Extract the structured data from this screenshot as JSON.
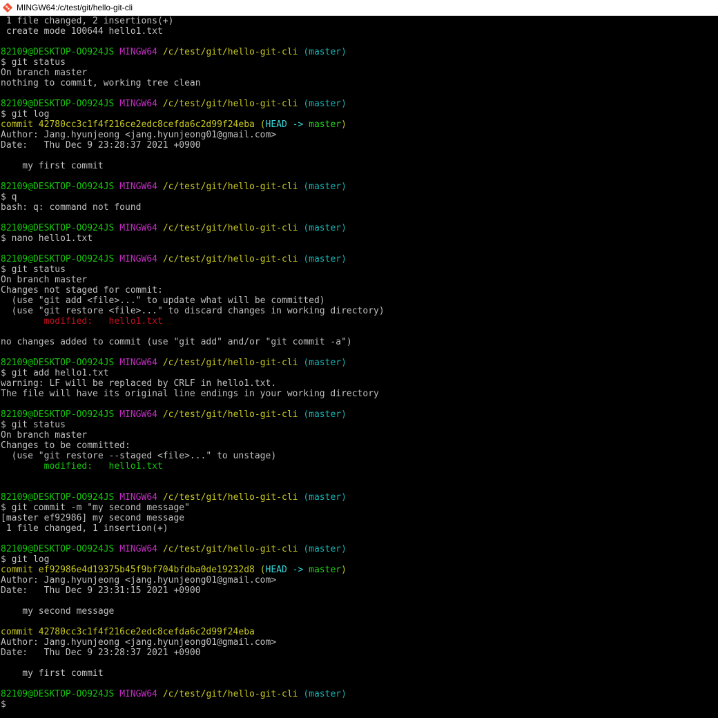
{
  "window": {
    "title": "MINGW64:/c/test/git/hello-git-cli"
  },
  "prompt": {
    "user_host": "82109@DESKTOP-OO924JS",
    "system": "MINGW64",
    "path": "/c/test/git/hello-git-cli",
    "branch": "(master)"
  },
  "colors": {
    "background": "#000000",
    "text": "#c0c0c0",
    "user_host": "#16c60c",
    "system": "#c030c0",
    "path": "#c9c920",
    "branch": "#19b2b2",
    "unstaged": "#c50f1f",
    "staged": "#16c60c"
  },
  "lines": [
    {
      "type": "text",
      "text": " 1 file changed, 2 insertions(+)"
    },
    {
      "type": "text",
      "text": " create mode 100644 hello1.txt"
    },
    {
      "type": "blank"
    },
    {
      "type": "prompt"
    },
    {
      "type": "cmd",
      "text": "$ git status"
    },
    {
      "type": "text",
      "text": "On branch master"
    },
    {
      "type": "text",
      "text": "nothing to commit, working tree clean"
    },
    {
      "type": "blank"
    },
    {
      "type": "prompt"
    },
    {
      "type": "cmd",
      "text": "$ git log"
    },
    {
      "type": "commit",
      "hash": "commit 42780cc3c1f4f216ce2edc8cefda6c2d99f24eba",
      "refs": {
        "open": " (",
        "head": "HEAD -> ",
        "branch": "master",
        "close": ")"
      }
    },
    {
      "type": "text",
      "text": "Author: Jang.hyunjeong <jang.hyunjeong01@gmail.com>"
    },
    {
      "type": "text",
      "text": "Date:   Thu Dec 9 23:28:37 2021 +0900"
    },
    {
      "type": "blank"
    },
    {
      "type": "text",
      "text": "    my first commit"
    },
    {
      "type": "blank"
    },
    {
      "type": "prompt"
    },
    {
      "type": "cmd",
      "text": "$ q"
    },
    {
      "type": "text",
      "text": "bash: q: command not found"
    },
    {
      "type": "blank"
    },
    {
      "type": "prompt"
    },
    {
      "type": "cmd",
      "text": "$ nano hello1.txt"
    },
    {
      "type": "blank"
    },
    {
      "type": "prompt"
    },
    {
      "type": "cmd",
      "text": "$ git status"
    },
    {
      "type": "text",
      "text": "On branch master"
    },
    {
      "type": "text",
      "text": "Changes not staged for commit:"
    },
    {
      "type": "text",
      "text": "  (use \"git add <file>...\" to update what will be committed)"
    },
    {
      "type": "text",
      "text": "  (use \"git restore <file>...\" to discard changes in working directory)"
    },
    {
      "type": "colored",
      "color": "red",
      "text": "        modified:   hello1.txt"
    },
    {
      "type": "blank"
    },
    {
      "type": "text",
      "text": "no changes added to commit (use \"git add\" and/or \"git commit -a\")"
    },
    {
      "type": "blank"
    },
    {
      "type": "prompt"
    },
    {
      "type": "cmd",
      "text": "$ git add hello1.txt"
    },
    {
      "type": "text",
      "text": "warning: LF will be replaced by CRLF in hello1.txt."
    },
    {
      "type": "text",
      "text": "The file will have its original line endings in your working directory"
    },
    {
      "type": "blank"
    },
    {
      "type": "prompt"
    },
    {
      "type": "cmd",
      "text": "$ git status"
    },
    {
      "type": "text",
      "text": "On branch master"
    },
    {
      "type": "text",
      "text": "Changes to be committed:"
    },
    {
      "type": "text",
      "text": "  (use \"git restore --staged <file>...\" to unstage)"
    },
    {
      "type": "colored",
      "color": "green",
      "text": "        modified:   hello1.txt"
    },
    {
      "type": "blank"
    },
    {
      "type": "blank"
    },
    {
      "type": "prompt"
    },
    {
      "type": "cmd",
      "text": "$ git commit -m \"my second message\""
    },
    {
      "type": "text",
      "text": "[master ef92986] my second message"
    },
    {
      "type": "text",
      "text": " 1 file changed, 1 insertion(+)"
    },
    {
      "type": "blank"
    },
    {
      "type": "prompt"
    },
    {
      "type": "cmd",
      "text": "$ git log"
    },
    {
      "type": "commit",
      "hash": "commit ef92986e4d19375b45f9bf704bfdba0de19232d8",
      "refs": {
        "open": " (",
        "head": "HEAD -> ",
        "branch": "master",
        "close": ")"
      }
    },
    {
      "type": "text",
      "text": "Author: Jang.hyunjeong <jang.hyunjeong01@gmail.com>"
    },
    {
      "type": "text",
      "text": "Date:   Thu Dec 9 23:31:15 2021 +0900"
    },
    {
      "type": "blank"
    },
    {
      "type": "text",
      "text": "    my second message"
    },
    {
      "type": "blank"
    },
    {
      "type": "commit",
      "hash": "commit 42780cc3c1f4f216ce2edc8cefda6c2d99f24eba"
    },
    {
      "type": "text",
      "text": "Author: Jang.hyunjeong <jang.hyunjeong01@gmail.com>"
    },
    {
      "type": "text",
      "text": "Date:   Thu Dec 9 23:28:37 2021 +0900"
    },
    {
      "type": "blank"
    },
    {
      "type": "text",
      "text": "    my first commit"
    },
    {
      "type": "blank"
    },
    {
      "type": "prompt"
    },
    {
      "type": "cmd",
      "text": "$"
    }
  ]
}
